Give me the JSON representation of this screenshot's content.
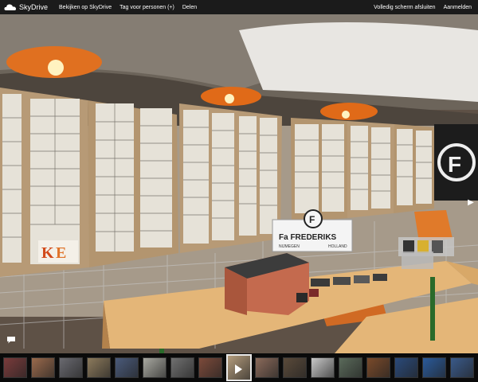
{
  "app": {
    "name": "SkyDrive"
  },
  "nav": {
    "view": "Bekijken op SkyDrive",
    "tag": "Tag voor personen (+)",
    "share": "Delen"
  },
  "actions": {
    "fullscreen": "Volledig scherm afsluiten",
    "signin": "Aanmelden"
  },
  "photo": {
    "sign_line1": "Fa FREDERIKS",
    "sign_line2": "NIJMEGEN",
    "sign_line3": "HOLLAND",
    "logo": "F"
  },
  "filmstrip": {
    "active_index": 8,
    "thumbs": [
      {
        "color": "#7a3b3b"
      },
      {
        "color": "#9a6a4c"
      },
      {
        "color": "#6a6a70"
      },
      {
        "color": "#8c7a5c"
      },
      {
        "color": "#4a5a7a"
      },
      {
        "color": "#a8a8a0"
      },
      {
        "color": "#707070"
      },
      {
        "color": "#7c4a3a"
      },
      {
        "color": "#b49c7c"
      },
      {
        "color": "#8a6a5a"
      },
      {
        "color": "#5a4a3a"
      },
      {
        "color": "#c8c8c8"
      },
      {
        "color": "#5a6a5a"
      },
      {
        "color": "#7a4a2a"
      },
      {
        "color": "#2a4a7a"
      },
      {
        "color": "#2a5a9a"
      },
      {
        "color": "#3a5a8a"
      }
    ]
  }
}
